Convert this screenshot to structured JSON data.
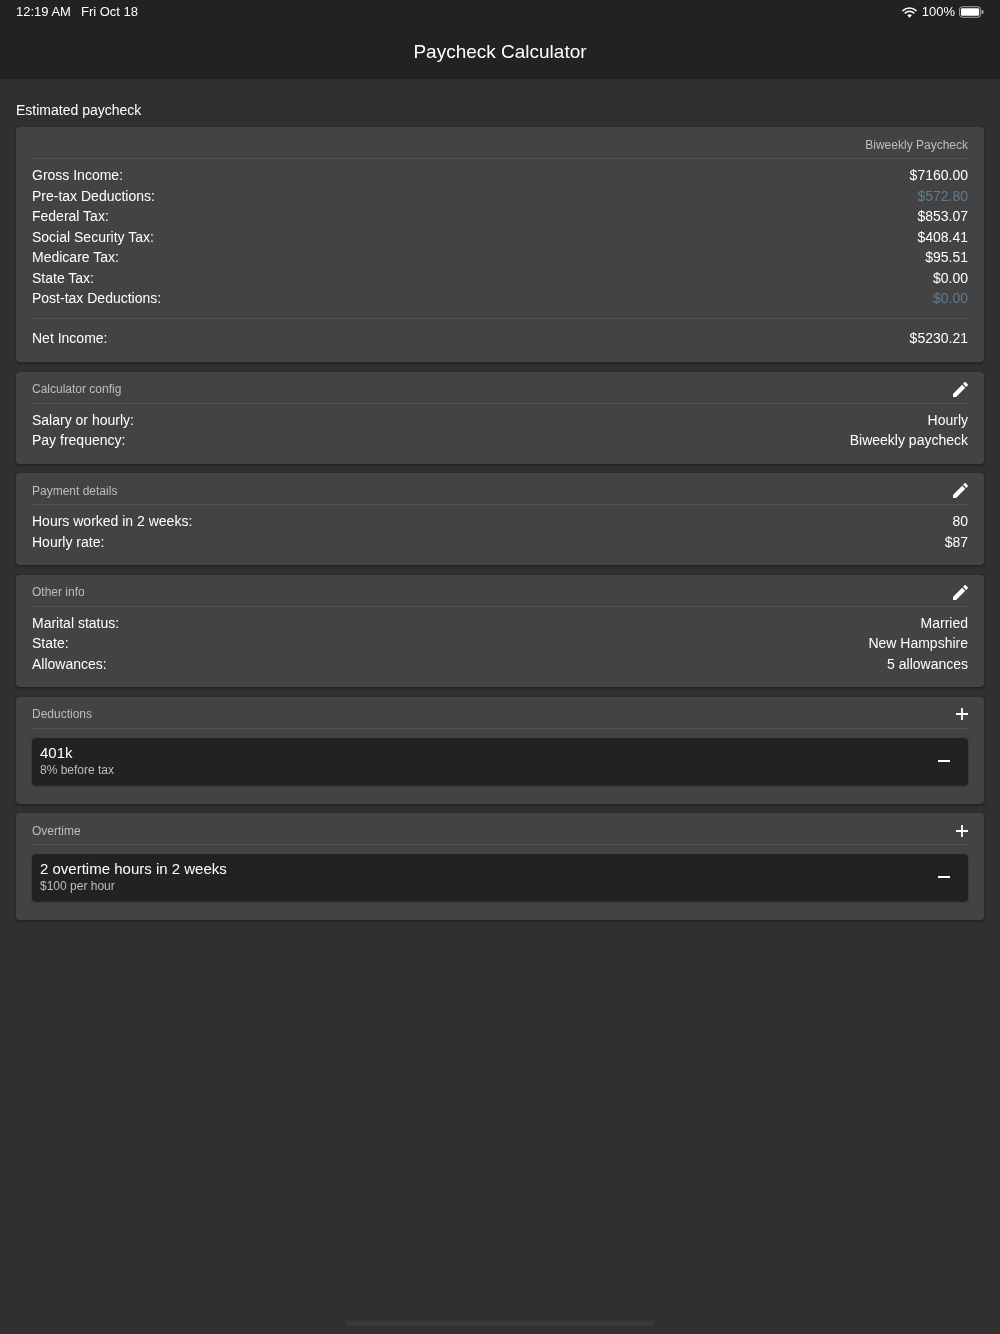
{
  "status_bar": {
    "time": "12:19 AM",
    "date": "Fri Oct 18",
    "battery": "100%"
  },
  "nav_bar": {
    "title": "Paycheck Calculator"
  },
  "section_title": "Estimated paycheck",
  "summary": {
    "period": "Biweekly Paycheck",
    "rows": [
      {
        "label": "Gross Income:",
        "value": "$7160.00",
        "kind": "amount"
      },
      {
        "label": "Pre-tax Deductions:",
        "value": "$572.80",
        "kind": "deduction"
      },
      {
        "label": "Federal Tax:",
        "value": "$853.07",
        "kind": "amount"
      },
      {
        "label": "Social Security Tax:",
        "value": "$408.41",
        "kind": "amount"
      },
      {
        "label": "Medicare Tax:",
        "value": "$95.51",
        "kind": "amount"
      },
      {
        "label": "State Tax:",
        "value": "$0.00",
        "kind": "amount"
      },
      {
        "label": "Post-tax Deductions:",
        "value": "$0.00",
        "kind": "deduction"
      }
    ],
    "total": {
      "label": "Net Income:",
      "value": "$5230.21"
    }
  },
  "cards": [
    {
      "title": "Calculator config",
      "kind": "details",
      "rows": [
        {
          "label": "Salary or hourly:",
          "value": "Hourly"
        },
        {
          "label": "Pay frequency:",
          "value": "Biweekly paycheck"
        }
      ]
    },
    {
      "title": "Payment details",
      "kind": "details",
      "rows": [
        {
          "label": "Hours worked in 2 weeks:",
          "value": "80"
        },
        {
          "label": "Hourly rate:",
          "value": "$87"
        }
      ]
    },
    {
      "title": "Other info",
      "kind": "details",
      "rows": [
        {
          "label": "Marital status:",
          "value": "Married"
        },
        {
          "label": "State:",
          "value": "New Hampshire"
        },
        {
          "label": "Allowances:",
          "value": "5 allowances"
        }
      ]
    },
    {
      "title": "Deductions",
      "kind": "list",
      "items": [
        {
          "title": "401k",
          "subtitle": "8% before tax"
        }
      ]
    },
    {
      "title": "Overtime",
      "kind": "list",
      "items": [
        {
          "title": "2 overtime hours in 2 weeks",
          "subtitle": "$100 per hour"
        }
      ]
    }
  ]
}
